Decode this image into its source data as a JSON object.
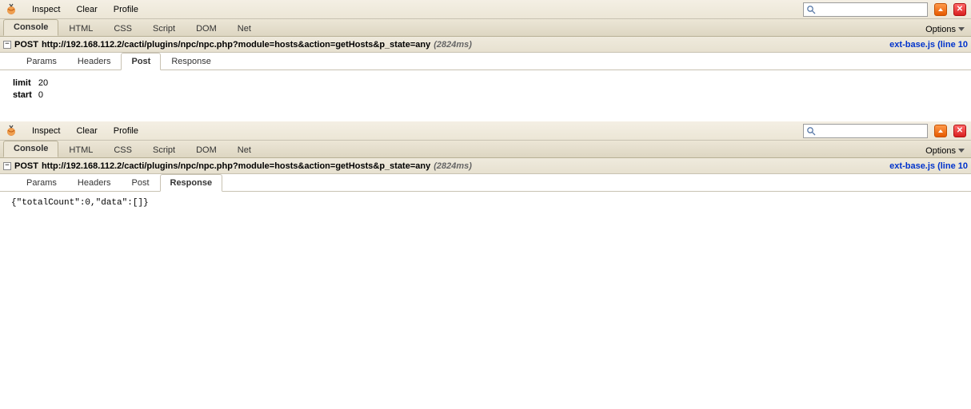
{
  "toolbar": {
    "inspect": "Inspect",
    "clear": "Clear",
    "profile": "Profile"
  },
  "tabs": {
    "console": "Console",
    "html": "HTML",
    "css": "CSS",
    "script": "Script",
    "dom": "DOM",
    "net": "Net",
    "options": "Options"
  },
  "instances": [
    {
      "request": {
        "method": "POST",
        "url": "http://192.168.112.2/cacti/plugins/npc/npc.php?module=hosts&action=getHosts&p_state=any",
        "timing": "(2824ms)",
        "source": "ext-base.js (line 10"
      },
      "subtabs": {
        "params": "Params",
        "headers": "Headers",
        "post": "Post",
        "response": "Response",
        "active": "post"
      },
      "post_params": [
        {
          "k": "limit",
          "v": "20"
        },
        {
          "k": "start",
          "v": "0"
        }
      ]
    },
    {
      "request": {
        "method": "POST",
        "url": "http://192.168.112.2/cacti/plugins/npc/npc.php?module=hosts&action=getHosts&p_state=any",
        "timing": "(2824ms)",
        "source": "ext-base.js (line 10"
      },
      "subtabs": {
        "params": "Params",
        "headers": "Headers",
        "post": "Post",
        "response": "Response",
        "active": "response"
      },
      "response_body": "{\"totalCount\":0,\"data\":[]}"
    }
  ]
}
